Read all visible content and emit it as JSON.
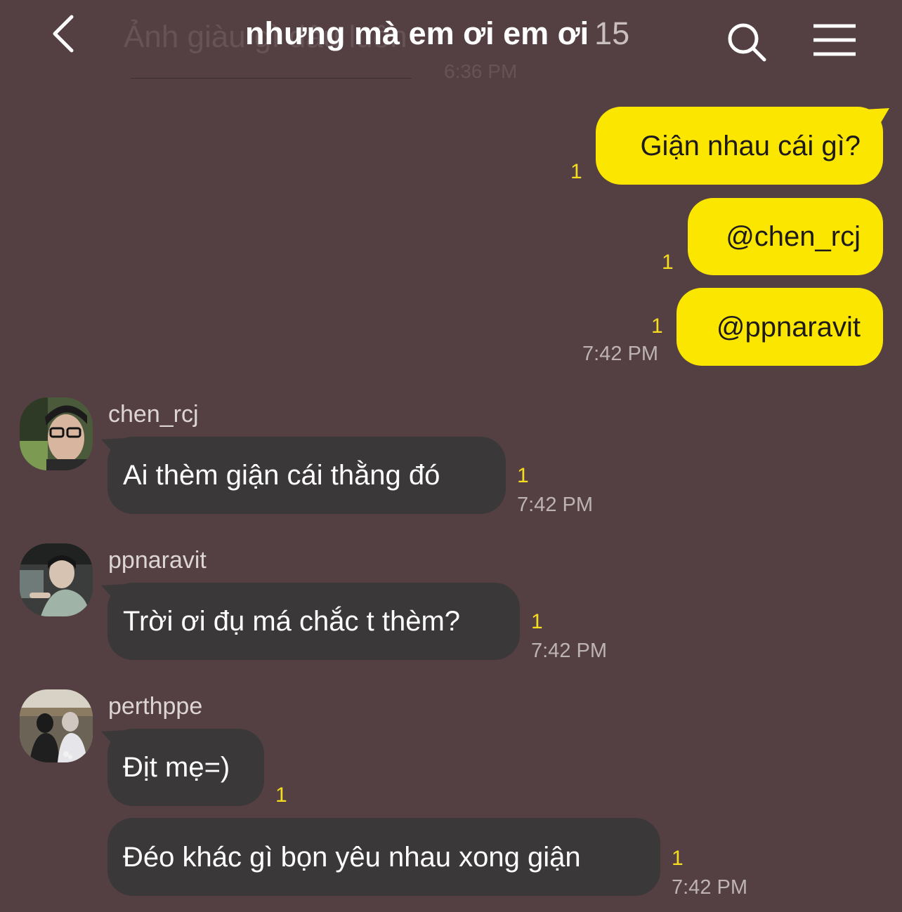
{
  "header": {
    "title": "nhưng mà em ơi em ơi",
    "member_count": "15",
    "icons": {
      "back": "chevron-left-icon",
      "search": "search-icon",
      "menu": "hamburger-menu-icon"
    }
  },
  "previous_message": {
    "text": "Ảnh giàu gì đâu luôn",
    "time": "6:36 PM"
  },
  "colors": {
    "background": "#544042",
    "my_bubble": "#fbe600",
    "their_bubble": "#3b3839",
    "unread": "#f5dc1f"
  },
  "my_messages": [
    {
      "text": "Giận nhau cái gì?",
      "unread": "1"
    },
    {
      "text": "@chen_rcj",
      "unread": "1"
    },
    {
      "text": "@ppnaravit",
      "unread": "1"
    }
  ],
  "my_messages_time": "7:42 PM",
  "groups": [
    {
      "sender": "chen_rcj",
      "messages": [
        {
          "text": "Ai thèm giận cái thằng đó",
          "unread": "1",
          "time": "7:42 PM"
        }
      ]
    },
    {
      "sender": "ppnaravit",
      "messages": [
        {
          "text": "Trời ơi đụ má chắc t thèm?",
          "unread": "1",
          "time": "7:42 PM"
        }
      ]
    },
    {
      "sender": "perthppe",
      "messages": [
        {
          "text": "Địt mẹ=)",
          "unread": "1"
        },
        {
          "text": "Đéo khác gì bọn yêu nhau xong giận",
          "unread": "1",
          "time": "7:42 PM"
        }
      ]
    }
  ]
}
